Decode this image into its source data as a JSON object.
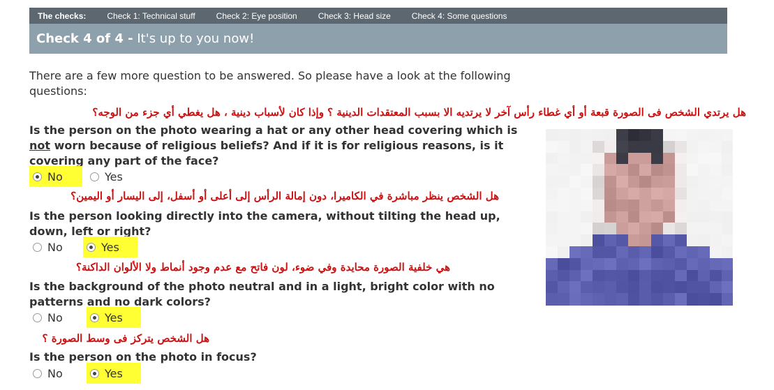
{
  "nav": {
    "label": "The checks:",
    "items": [
      "Check 1: Technical stuff",
      "Check 2: Eye position",
      "Check 3: Head size",
      "Check 4: Some questions"
    ]
  },
  "header": {
    "title_bold": "Check 4 of 4 -",
    "title_rest": " It's up to you now!"
  },
  "intro": "There are a few more question to be answered. So please have a look at the following questions:",
  "questions": [
    {
      "arabic": "هل يرتدي الشخص فى الصورة قبعة أو أي غطاء رأس آخر لا يرتديه الا بسبب المعتقدات الدينية ؟ وإذا كان لأسباب دينية ، هل يغطي أي جزء من الوجه؟",
      "text_pre": "Is the person on the photo wearing a hat or any other head covering which is ",
      "text_underline": "not",
      "text_post": " worn because of religious beliefs? And if it is for religious reasons, is it covering any part of the face?",
      "options": [
        "No",
        "Yes"
      ],
      "selected": "No"
    },
    {
      "arabic": "هل الشخص ينظر مباشرة في الكاميرا، دون إمالة الرأس إلى أعلى أو أسفل، إلى اليسار أو اليمين؟",
      "text": "Is the person looking directly into the camera, without tilting the head up, down, left or right?",
      "options": [
        "No",
        "Yes"
      ],
      "selected": "Yes"
    },
    {
      "arabic": "هي خلفية الصورة محايدة وفي ضوء، لون فاتح  مع عدم وجود أنماط ولا الألوان الداكنة؟",
      "text": "Is the background of the photo neutral and in a light, bright color with no patterns and no dark colors?",
      "options": [
        "No",
        "Yes"
      ],
      "selected": "Yes"
    },
    {
      "arabic": "هل الشخص يتركز فى وسط الصورة ؟",
      "text": "Is the person on the photo in focus?",
      "options": [
        "No",
        "Yes"
      ],
      "selected": "Yes"
    }
  ],
  "photo": {
    "description_icon": "pixelated-portrait",
    "colors": {
      "bg": "#f4f4f4",
      "skin": "#c89a98",
      "hair": "#3a3a44",
      "shirt": "#5b5fae"
    }
  }
}
